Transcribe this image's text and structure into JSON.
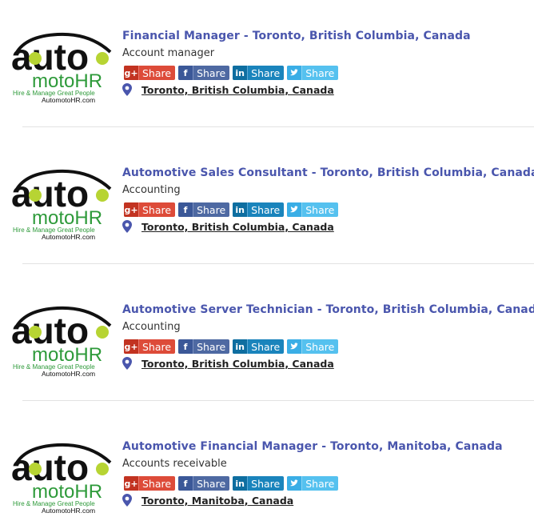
{
  "brand": {
    "logo_word": "auto",
    "logo_sub": "motoHR",
    "tagline": "Hire & Manage Great People",
    "site": "AutomotoHR.com"
  },
  "share": {
    "google_label": "Share",
    "facebook_label": "Share",
    "linkedin_label": "Share",
    "twitter_label": "Share",
    "google_glyph": "g+",
    "facebook_glyph": "f",
    "linkedin_glyph": "in"
  },
  "jobs": [
    {
      "title": "Financial Manager - Toronto, British Columbia, Canada",
      "category": "Account manager",
      "location": "Toronto, British Columbia, Canada"
    },
    {
      "title": "Automotive Sales Consultant - Toronto, British Columbia, Canada",
      "category": "Accounting",
      "location": "Toronto, British Columbia, Canada"
    },
    {
      "title": "Automotive Server Technician - Toronto, British Columbia, Canada",
      "category": "Accounting",
      "location": "Toronto, British Columbia, Canada"
    },
    {
      "title": "Automotive Financial Manager - Toronto, Manitoba, Canada",
      "category": "Accounts receivable",
      "location": "Toronto, Manitoba, Canada"
    }
  ],
  "colors": {
    "title": "#4a56ad",
    "google": "#dd4b39",
    "facebook": "#4e69a2",
    "linkedin": "#1a84bc",
    "twitter": "#55c1ef",
    "pin": "#4a56ad",
    "logo_green": "#2e9a3a",
    "logo_lime": "#b7d433"
  }
}
